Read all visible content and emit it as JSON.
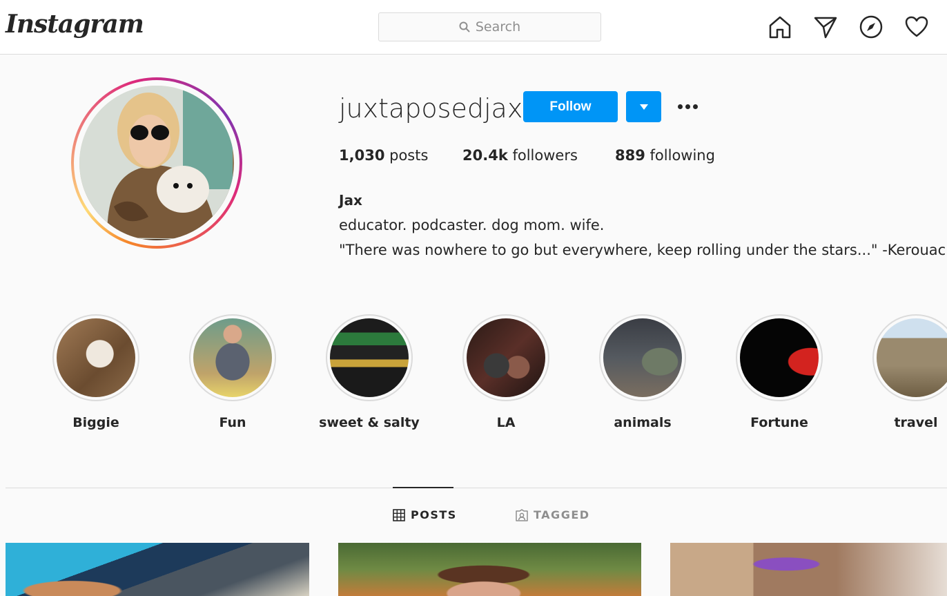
{
  "topnav": {
    "logo": "Instagram",
    "search_placeholder": "Search",
    "icons": [
      "home-icon",
      "direct-icon",
      "explore-icon",
      "activity-heart-icon"
    ]
  },
  "profile": {
    "username": "juxtaposedjax",
    "follow_label": "Follow",
    "stats": {
      "posts_count": "1,030",
      "posts_label": "posts",
      "followers_count": "20.4k",
      "followers_label": "followers",
      "following_count": "889",
      "following_label": "following"
    },
    "bio": {
      "name": "Jax",
      "line1": "educator. podcaster. dog mom. wife.",
      "line2": "\"There was nowhere to go but everywhere, keep rolling under the stars...\" -Kerouac"
    }
  },
  "highlights": [
    {
      "label": "Biggie"
    },
    {
      "label": "Fun"
    },
    {
      "label": "sweet & salty"
    },
    {
      "label": "LA"
    },
    {
      "label": "animals"
    },
    {
      "label": "Fortune"
    },
    {
      "label": "travel"
    }
  ],
  "tabs": {
    "posts": "POSTS",
    "tagged": "TAGGED",
    "active": "posts"
  },
  "colors": {
    "accent": "#0095f6",
    "text": "#262626",
    "muted": "#8e8e8e",
    "border": "#dbdbdb",
    "background": "#fafafa"
  }
}
